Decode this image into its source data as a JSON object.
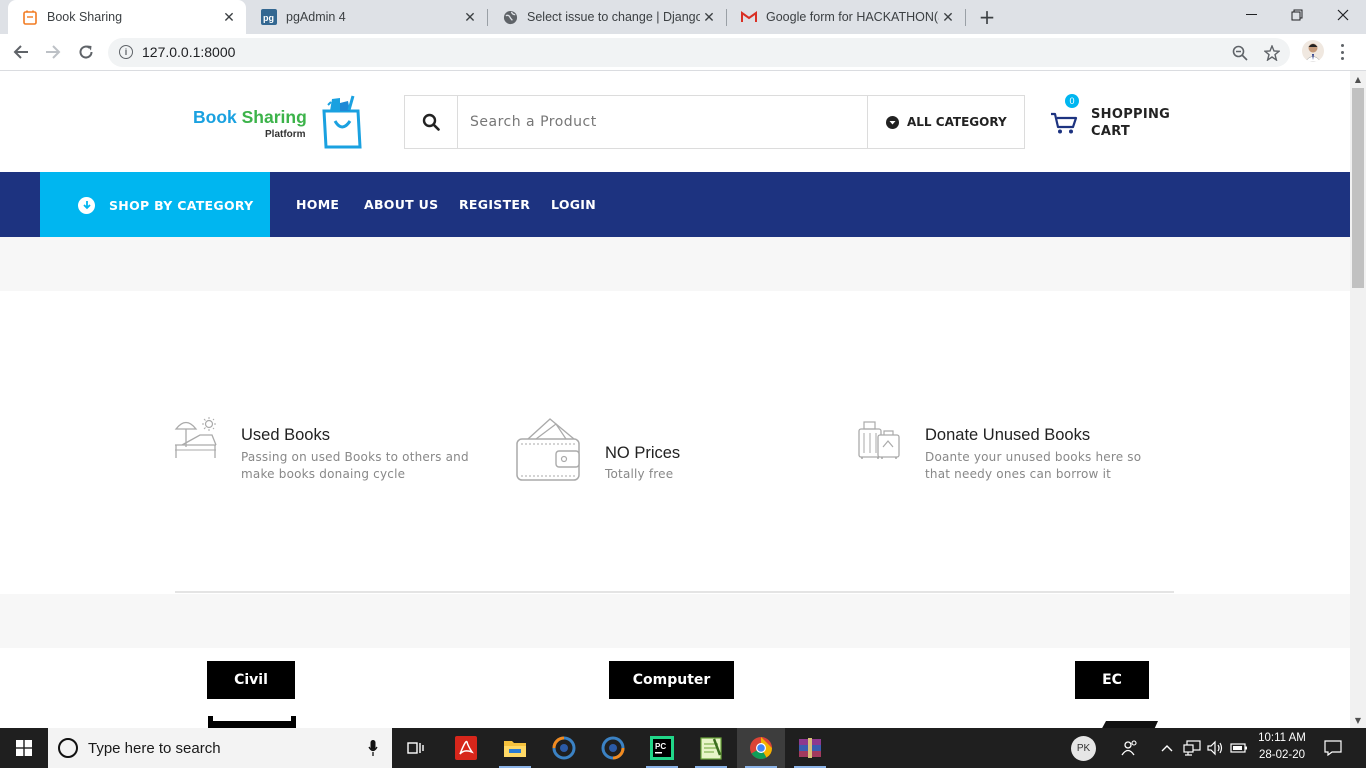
{
  "browser": {
    "tabs": [
      {
        "title": "Book Sharing",
        "icon": "book-sharing-favicon",
        "active": true
      },
      {
        "title": "pgAdmin 4",
        "icon": "pgadmin-favicon",
        "active": false
      },
      {
        "title": "Select issue to change | Django s",
        "icon": "globe-icon",
        "active": false
      },
      {
        "title": "Google form for HACKATHON(SS",
        "icon": "gmail-icon",
        "active": false
      }
    ],
    "url": "127.0.0.1:8000"
  },
  "header": {
    "logo_word1": "Book",
    "logo_word2": "Sharing",
    "logo_sub": "Platform",
    "search_placeholder": "Search a Product",
    "category_label": "ALL CATEGORY",
    "cart_count": "0",
    "cart_line1": "SHOPPING",
    "cart_line2": "CART"
  },
  "nav": {
    "shop_by_category": "SHOP BY CATEGORY",
    "links": [
      "HOME",
      "ABOUT US",
      "REGISTER",
      "LOGIN"
    ]
  },
  "features": [
    {
      "title": "Used Books",
      "desc": "Passing on used Books to others and make books donaing cycle",
      "icon": "beach-chair-icon"
    },
    {
      "title": "NO Prices",
      "desc": "Totally free",
      "icon": "wallet-icon"
    },
    {
      "title": "Donate Unused Books",
      "desc": "Doante your unused books here so that needy ones can borrow it",
      "icon": "luggage-icon"
    }
  ],
  "categories": [
    "Civil",
    "Computer",
    "EC"
  ],
  "taskbar": {
    "search_placeholder": "Type here to search",
    "user_initials": "PK",
    "time": "10:11 AM",
    "date": "28-02-20"
  },
  "colors": {
    "nav_bg": "#1d3380",
    "accent": "#00b6f0",
    "logo_blue": "#1aa1e0",
    "logo_green": "#3cb34a"
  }
}
